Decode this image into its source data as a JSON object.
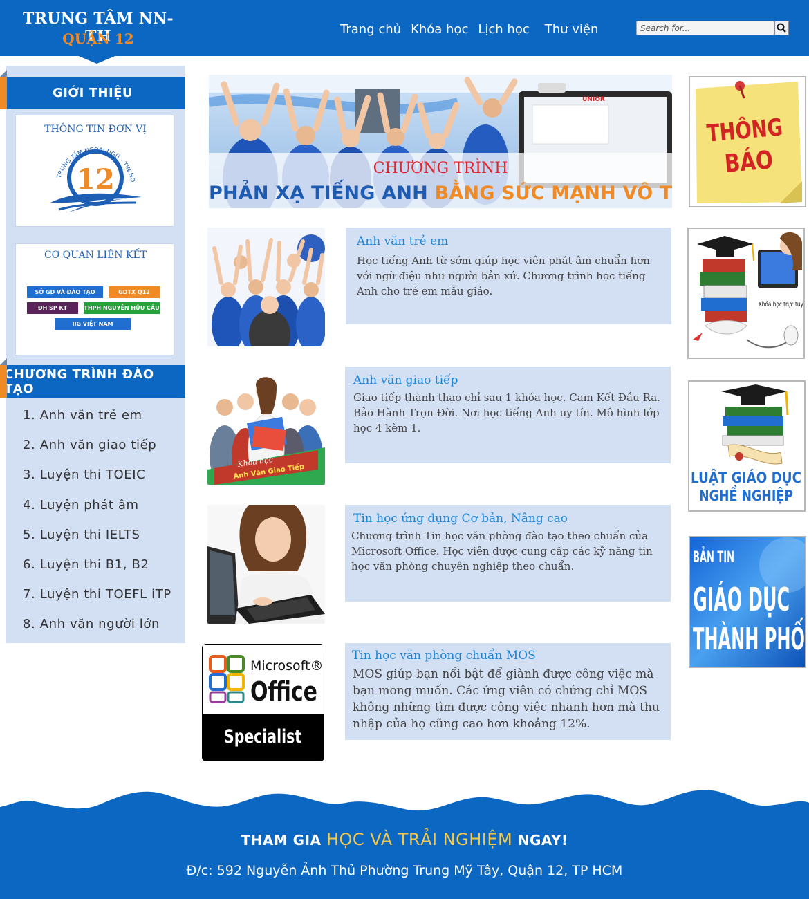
{
  "header": {
    "logo_line1": "TRUNG TÂM NN-TH",
    "logo_line2": "QUẬN 12",
    "nav": [
      "Trang chủ",
      "Khóa học",
      "Lịch học",
      "Thư viện"
    ],
    "search_placeholder": "Search for...",
    "colors": {
      "brand_blue": "#0b67c2",
      "accent_orange": "#f08a24"
    }
  },
  "sidebar": {
    "intro_heading": "GIỚI THIỆU",
    "unit_info_title": "THÔNG TIN ĐƠN VỊ",
    "unit_logo": {
      "number": "12",
      "ring_text": "TRUNG TÂM NGOẠI NGỮ - TIN HỌC"
    },
    "partners_title": "CƠ QUAN LIÊN KẾT",
    "partners": [
      "SỞ GD VÀ ĐÀO TẠO",
      "GDTX Q12",
      "ĐH SP KT",
      "THPH NGUYỄN HỮU CẦU",
      "IIG VIỆT NAM"
    ],
    "programs_heading": "CHƯƠNG TRÌNH ĐÀO TẠO",
    "programs": [
      "1. Anh văn trẻ em",
      "2. Anh văn giao tiếp",
      "3. Luyện thi TOEIC",
      "4. Luyện phát âm",
      "5. Luyện thi IELTS",
      "6. Luyện thi B1, B2",
      "7. Luyện thi TOEFL iTP",
      "8. Anh văn người lớn"
    ]
  },
  "banner": {
    "line1": "CHƯƠNG TRÌNH",
    "line2_part1": "PHẢN XẠ TIẾNG ANH",
    "line2_part2": "BẰNG SỨC MẠNH VÔ THỨC",
    "board_brand": "UNIOR"
  },
  "courses": [
    {
      "title": "Anh văn trẻ em",
      "text": "Học tiếng Anh từ sớm giúp học viên phát âm chuẩn hơn với ngữ điệu như người bản xứ. Chương trình học tiếng Anh cho trẻ em mẫu giáo."
    },
    {
      "title": "Anh văn giao tiếp",
      "text": "Giao tiếp thành thạo chỉ sau 1 khóa học. Cam Kết Đầu Ra. Bảo Hành Trọn Đời. Nơi học tiếng Anh uy tín. Mô hình lớp học 4 kèm 1.",
      "image_caption_1": "Khóa học",
      "image_caption_2": "Anh Văn Giao Tiếp"
    },
    {
      "title": "Tin học ứng dụng Cơ bản, Nâng cao",
      "text": "Chương trình Tin học văn phòng đào tạo theo chuẩn của Microsoft Office. Học viên được cung cấp các kỹ năng tin học văn phòng chuyên nghiệp theo chuẩn."
    },
    {
      "title": "Tin học văn phòng chuẩn MOS",
      "text": "MOS giúp bạn nổi bật để giành được công việc mà bạn mong muốn. Các ứng viên có chứng chỉ MOS không những tìm được công việc nhanh hơn mà thu nhập của họ cũng cao hơn khoảng 12%.",
      "badge_line1": "Microsoft®",
      "badge_line2": "Office",
      "badge_line3": "Specialist"
    }
  ],
  "right_column": {
    "notice_line1": "THÔNG",
    "notice_line2": "BÁO",
    "online_course": "Khóa học trực tuyến",
    "vocational_law_line1": "LUẬT GIÁO DỤC",
    "vocational_law_line2": "NGHỀ NGHIỆP",
    "city_news_line1": "BẢN TIN",
    "city_news_line2": "GIÁO DỤC",
    "city_news_line3": "THÀNH PHỐ"
  },
  "footer": {
    "cta_prefix": "THAM GIA",
    "cta_highlight": "HỌC VÀ TRẢI NGHIỆM",
    "cta_suffix": "NGAY!",
    "address": "Đ/c: 592 Nguyễn Ảnh Thủ Phường Trung Mỹ Tây, Quận 12, TP HCM"
  }
}
